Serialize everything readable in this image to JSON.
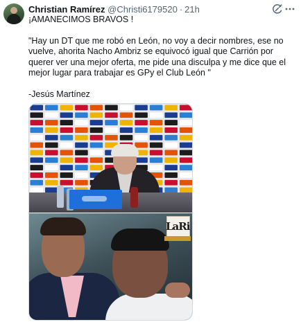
{
  "tweet": {
    "author": {
      "display_name": "Christian Ramírez",
      "handle": "@Christi6179520",
      "separator": "·",
      "time": "21h"
    },
    "text": {
      "line1": "¡AMANECIMOS BRAVOS !",
      "quote": "\"Hay un DT que me robó en León, no voy a decir nombres, ese no vuelve, ahorita Nacho Ambriz se equivocó igual que Carrión por querer ver una mejor oferta, me pide una disculpa y me dice que el mejor lugar para trabajar es GPy el Club León \"",
      "attribution": "-Jesús Martínez"
    },
    "icons": {
      "grok": "grok-icon",
      "more": "more-icon"
    },
    "media": {
      "top_photo": "press-conference-photo",
      "bottom_photo": "embrace-photo",
      "watermark_text": "LaRi"
    }
  }
}
